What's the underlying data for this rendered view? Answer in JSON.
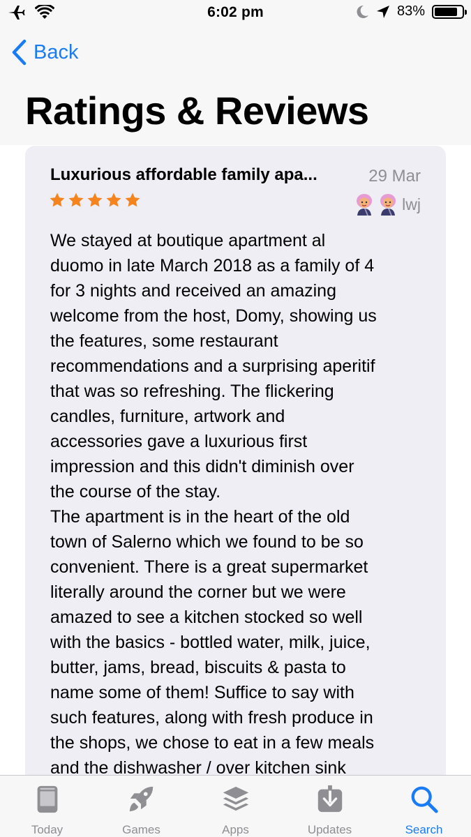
{
  "status_bar": {
    "time": "6:02 pm",
    "battery_percent": "83%",
    "battery_level": 0.83,
    "icons": [
      "airplane-icon",
      "wifi-icon",
      "moon-icon",
      "location-arrow-icon",
      "battery-icon"
    ]
  },
  "header": {
    "back_label": "Back",
    "title": "Ratings & Reviews"
  },
  "review": {
    "title": "Luxurious affordable family apa...",
    "date": "29 Mar",
    "rating": 5,
    "rating_max": 5,
    "author": "lwj",
    "star_color": "#f5841f",
    "body": "We stayed at boutique apartment al\nduomo in late March 2018 as a family of 4\nfor 3 nights and received an amazing\nwelcome from the host, Domy, showing us\nthe features, some restaurant\nrecommendations and a surprising aperitif\nthat was so refreshing.  The flickering\ncandles, furniture, artwork and\naccessories gave a luxurious first\nimpression and this didn't diminish over\nthe course of the stay.\nThe apartment is in the heart of the old\ntown of Salerno which we found to be so\nconvenient. There is a great supermarket\nliterally around the corner but we were\namazed to see a kitchen stocked so well\nwith the basics - bottled water, milk, juice,\nbutter, jams, bread, biscuits & pasta to\nname some of them!  Suffice to say with\nsuch features, along with fresh produce in\nthe shops, we chose to eat in a few meals\nand the dishwasher / over kitchen sink"
  },
  "tab_bar": {
    "tabs": [
      {
        "label": "Today",
        "icon": "today-icon",
        "active": false
      },
      {
        "label": "Games",
        "icon": "rocket-icon",
        "active": false
      },
      {
        "label": "Apps",
        "icon": "apps-stack-icon",
        "active": false
      },
      {
        "label": "Updates",
        "icon": "updates-download-icon",
        "active": false
      },
      {
        "label": "Search",
        "icon": "search-icon",
        "active": true
      }
    ],
    "active_color": "#1a7cf5",
    "inactive_color": "#8e8e93"
  }
}
